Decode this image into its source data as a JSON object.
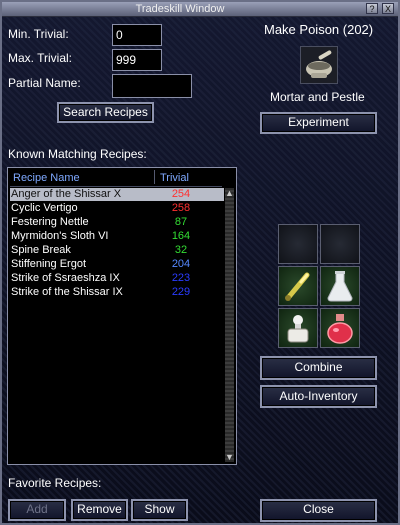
{
  "window": {
    "title": "Tradeskill Window",
    "help_btn": "?",
    "close_btn": "X"
  },
  "search": {
    "min_trivial_label": "Min. Trivial:",
    "min_trivial_value": "0",
    "max_trivial_label": "Max. Trivial:",
    "max_trivial_value": "999",
    "partial_name_label": "Partial Name:",
    "partial_name_value": "",
    "search_button": "Search Recipes"
  },
  "container": {
    "title": "Make Poison (202)",
    "icon": "mortar-and-pestle-icon",
    "name": "Mortar and Pestle",
    "experiment_button": "Experiment"
  },
  "recipes": {
    "section_label": "Known Matching Recipes:",
    "col_name": "Recipe Name",
    "col_trivial": "Trivial",
    "selected_index": 0,
    "rows": [
      {
        "name": "Anger of the Shissar X",
        "trivial": "254",
        "color": "#ff3030"
      },
      {
        "name": "Cyclic Vertigo",
        "trivial": "258",
        "color": "#ff3030"
      },
      {
        "name": "Festering Nettle",
        "trivial": "87",
        "color": "#33dd33"
      },
      {
        "name": "Myrmidon's Sloth VI",
        "trivial": "164",
        "color": "#33dd33"
      },
      {
        "name": "Spine Break",
        "trivial": "32",
        "color": "#33dd33"
      },
      {
        "name": "Stiffening Ergot",
        "trivial": "204",
        "color": "#5588ff"
      },
      {
        "name": "Strike of Ssraeshza IX",
        "trivial": "223",
        "color": "#2a3cff"
      },
      {
        "name": "Strike of the Shissar IX",
        "trivial": "229",
        "color": "#2a3cff"
      }
    ]
  },
  "slots": [
    {
      "icon": "",
      "filled": false
    },
    {
      "icon": "",
      "filled": false
    },
    {
      "icon": "glowing-vial-icon",
      "filled": true
    },
    {
      "icon": "flask-icon",
      "filled": true
    },
    {
      "icon": "perfume-bottle-icon",
      "filled": true
    },
    {
      "icon": "red-flask-icon",
      "filled": true
    }
  ],
  "actions": {
    "combine": "Combine",
    "auto_inventory": "Auto-Inventory",
    "close": "Close"
  },
  "favorites": {
    "label": "Favorite Recipes:",
    "add": "Add",
    "remove": "Remove",
    "show": "Show"
  }
}
